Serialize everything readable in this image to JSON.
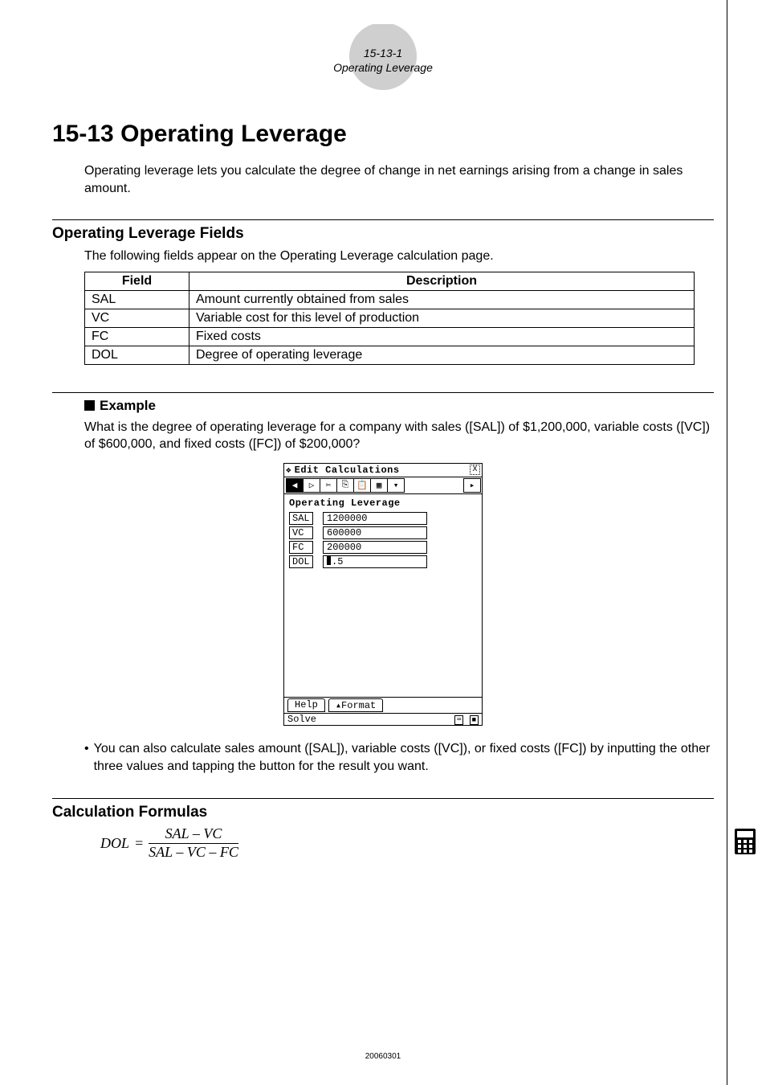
{
  "header": {
    "section_num": "15-13-1",
    "section_name": "Operating Leverage"
  },
  "title": "15-13  Operating Leverage",
  "intro": "Operating leverage lets you calculate the degree of change in net earnings arising from a change in sales amount.",
  "fields_section": {
    "heading": "Operating Leverage Fields",
    "lead": "The following fields appear on the Operating Leverage calculation page.",
    "col1": "Field",
    "col2": "Description",
    "rows": [
      {
        "field": "SAL",
        "desc": "Amount currently obtained from sales"
      },
      {
        "field": "VC",
        "desc": "Variable cost for this level of production"
      },
      {
        "field": "FC",
        "desc": "Fixed costs"
      },
      {
        "field": "DOL",
        "desc": "Degree of operating leverage"
      }
    ]
  },
  "example": {
    "heading": "Example",
    "text": "What is the degree of operating leverage for a company with sales ([SAL]) of $1,200,000, variable costs ([VC]) of $600,000, and fixed costs ([FC]) of $200,000?"
  },
  "calc": {
    "menu_edit": "Edit",
    "menu_calc": "Calculations",
    "heading": "Operating Leverage",
    "rows": [
      {
        "label": "SAL",
        "value": "1200000"
      },
      {
        "label": "VC",
        "value": "600000"
      },
      {
        "label": "FC",
        "value": "200000"
      },
      {
        "label": "DOL",
        "value": ".5",
        "highlight": true
      }
    ],
    "help": "Help",
    "format": "Format",
    "status": "Solve"
  },
  "note": "You can also calculate sales amount ([SAL]), variable costs ([VC]), or fixed costs ([FC]) by inputting the other three values and tapping the button for the result you want.",
  "formulas": {
    "heading": "Calculation Formulas",
    "lhs": "DOL",
    "numer": "SAL – VC",
    "denom": "SAL – VC – FC"
  },
  "footer": "20060301"
}
